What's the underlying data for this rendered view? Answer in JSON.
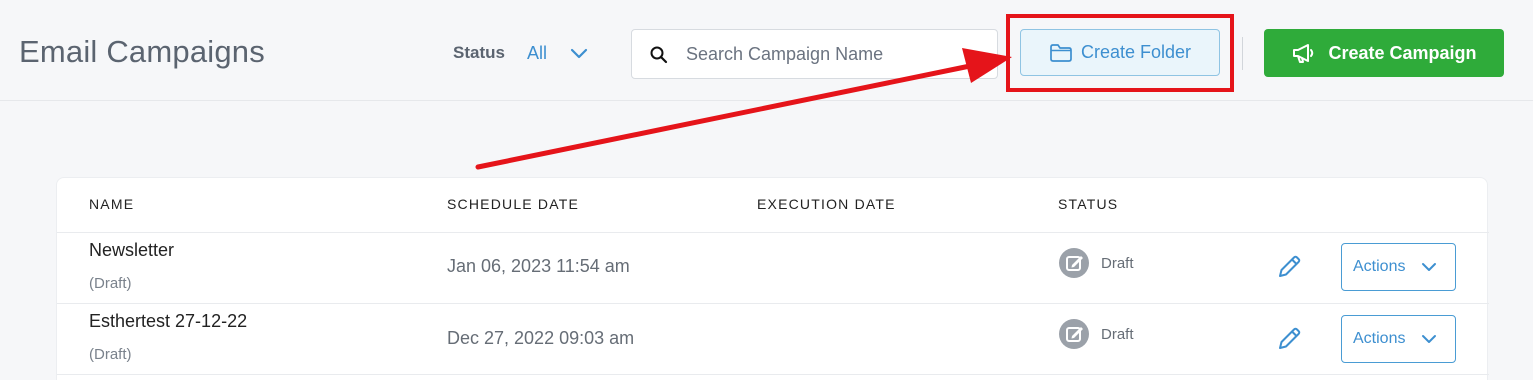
{
  "header": {
    "title": "Email Campaigns",
    "status_label": "Status",
    "status_value": "All",
    "search_placeholder": "Search Campaign Name",
    "create_folder_label": "Create Folder",
    "create_campaign_label": "Create Campaign"
  },
  "table": {
    "columns": [
      "NAME",
      "SCHEDULE DATE",
      "EXECUTION DATE",
      "STATUS"
    ],
    "rows": [
      {
        "name": "Newsletter",
        "sub": "(Draft)",
        "schedule_date": "Jan 06, 2023 11:54 am",
        "execution_date": "",
        "status": "Draft",
        "actions_label": "Actions"
      },
      {
        "name": "Esthertest 27-12-22",
        "sub": "(Draft)",
        "schedule_date": "Dec 27, 2022 09:03 am",
        "execution_date": "",
        "status": "Draft",
        "actions_label": "Actions"
      }
    ]
  },
  "colors": {
    "accent_blue": "#3d8fd0",
    "brand_green": "#2fab3a",
    "highlight_red": "#e5141a"
  },
  "icons": [
    "search-icon",
    "chevron-down-icon",
    "folder-icon",
    "megaphone-icon",
    "draft-status-icon",
    "pencil-edit-icon"
  ]
}
